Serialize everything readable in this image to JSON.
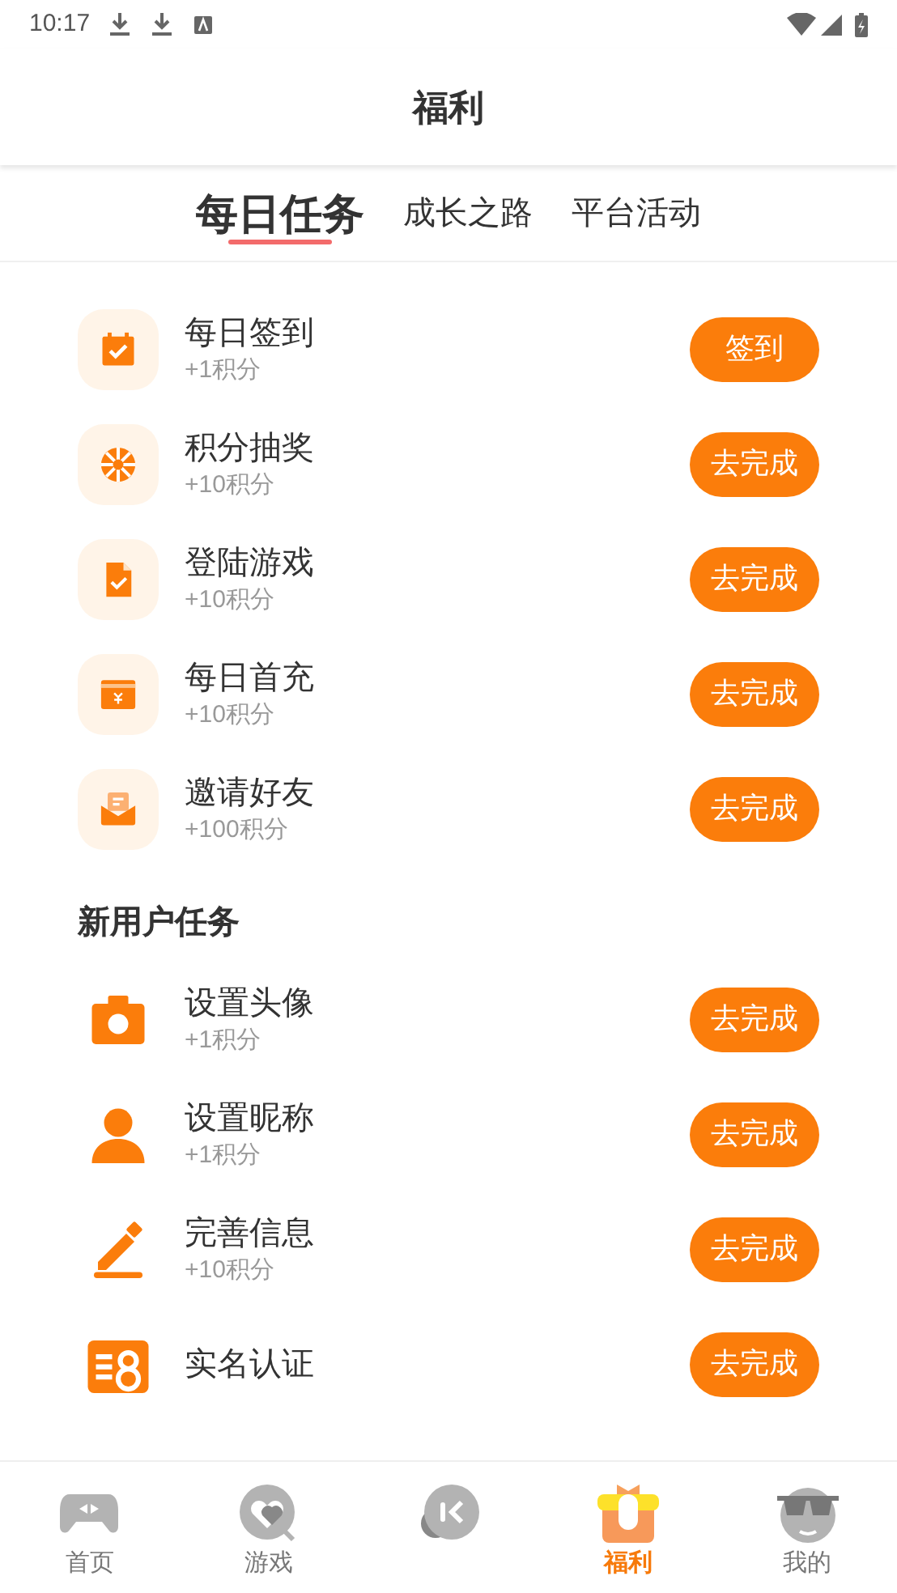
{
  "status_bar": {
    "time": "10:17"
  },
  "header": {
    "title": "福利"
  },
  "tabs": [
    {
      "label": "每日任务",
      "selected": true
    },
    {
      "label": "成长之路",
      "selected": false
    },
    {
      "label": "平台活动",
      "selected": false
    }
  ],
  "daily_tasks": [
    {
      "kind": "calendar",
      "title": "每日签到",
      "reward": "+1积分",
      "button": "签到"
    },
    {
      "kind": "wheel",
      "title": "积分抽奖",
      "reward": "+10积分",
      "button": "去完成"
    },
    {
      "kind": "document",
      "title": "登陆游戏",
      "reward": "+10积分",
      "button": "去完成"
    },
    {
      "kind": "card",
      "title": "每日首充",
      "reward": "+10积分",
      "button": "去完成"
    },
    {
      "kind": "envelope",
      "title": "邀请好友",
      "reward": "+100积分",
      "button": "去完成"
    }
  ],
  "new_user_section": {
    "title": "新用户任务"
  },
  "new_user_tasks": [
    {
      "kind": "camera",
      "title": "设置头像",
      "reward": "+1积分",
      "button": "去完成"
    },
    {
      "kind": "person",
      "title": "设置昵称",
      "reward": "+1积分",
      "button": "去完成"
    },
    {
      "kind": "pencil",
      "title": "完善信息",
      "reward": "+10积分",
      "button": "去完成"
    },
    {
      "kind": "id-card",
      "title": "实名认证",
      "button": "去完成"
    }
  ],
  "bottom_nav": [
    {
      "kind": "gamepad",
      "label": "首页",
      "selected": false
    },
    {
      "kind": "heart-bubble",
      "label": "游戏",
      "selected": false
    },
    {
      "kind": "chat"
    },
    {
      "kind": "gift",
      "label": "福利",
      "selected": true
    },
    {
      "kind": "sunglasses",
      "label": "我的",
      "selected": false
    }
  ]
}
